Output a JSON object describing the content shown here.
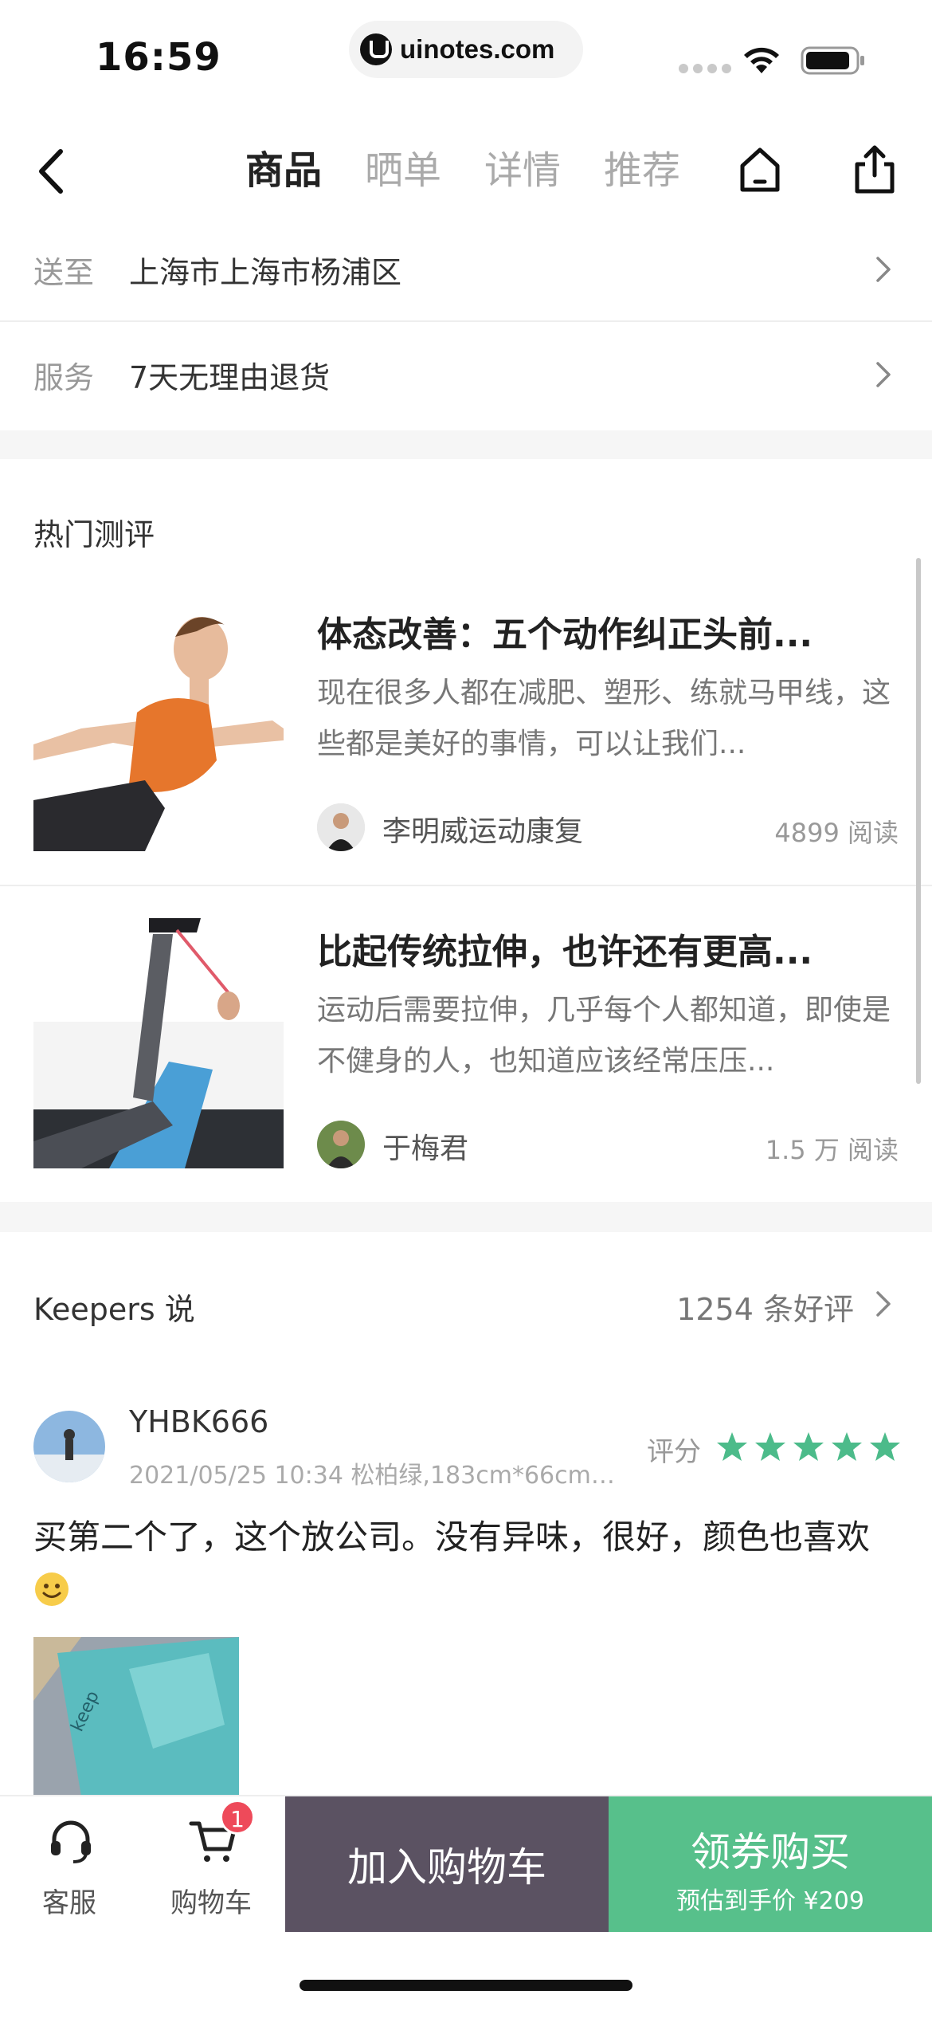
{
  "status_bar": {
    "time": "16:59",
    "url": "uinotes.com"
  },
  "nav": {
    "tabs": [
      {
        "label": "商品",
        "active": true
      },
      {
        "label": "晒单",
        "active": false
      },
      {
        "label": "详情",
        "active": false
      },
      {
        "label": "推荐",
        "active": false
      }
    ]
  },
  "delivery": {
    "label": "送至",
    "value": "上海市上海市杨浦区"
  },
  "service": {
    "label": "服务",
    "value": "7天无理由退货"
  },
  "hot_reviews": {
    "title": "热门测评",
    "articles": [
      {
        "title": "体态改善：五个动作纠正头前...",
        "desc": "现在很多人都在减肥、塑形、练就马甲线，这些都是美好的事情，可以让我们...",
        "author": "李明威运动康复",
        "reads": "4899 阅读"
      },
      {
        "title": "比起传统拉伸，也许还有更高...",
        "desc": "运动后需要拉伸，几乎每个人都知道，即使是不健身的人，也知道应该经常压压...",
        "author": "于梅君",
        "reads": "1.5 万 阅读"
      }
    ]
  },
  "keepers": {
    "title": "Keepers 说",
    "count": "1254 条好评",
    "review": {
      "user": "YHBK666",
      "meta": "2021/05/25 10:34 松柏绿,183cm*66cm*0...",
      "rating_label": "评分",
      "rating": 5,
      "text": "买第二个了，这个放公司。没有异味，很好，颜色也喜欢",
      "photo_brand": "keep"
    }
  },
  "bottom_bar": {
    "service_label": "客服",
    "cart_label": "购物车",
    "cart_badge": "1",
    "add_to_cart": "加入购物车",
    "buy_label": "领券购买",
    "buy_sub": "预估到手价 ¥209"
  },
  "colors": {
    "accent_green": "#57c08b",
    "cart_button": "#5b5262",
    "badge_red": "#ee4a5a",
    "star_green": "#4cbb8a"
  }
}
